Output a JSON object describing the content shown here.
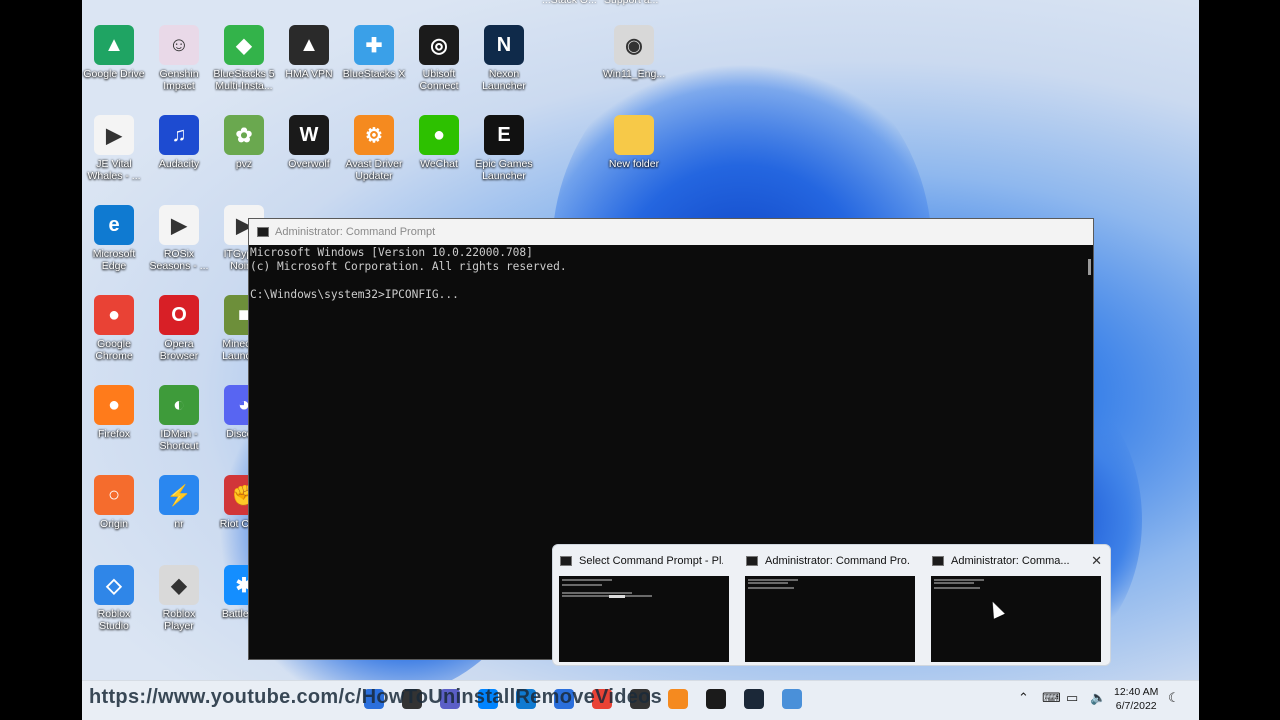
{
  "desktop_icons": [
    {
      "label": "Google Drive",
      "color": "#1fa463",
      "glyph": "▲"
    },
    {
      "label": "Genshin Impact",
      "color": "#e9d9e8",
      "glyph": "☺"
    },
    {
      "label": "BlueStacks 5 Multi-Insta...",
      "color": "#33b34a",
      "glyph": "◆"
    },
    {
      "label": "HMA VPN",
      "color": "#2a2a2a",
      "glyph": "▲"
    },
    {
      "label": "BlueStacks X",
      "color": "#3aa0e8",
      "glyph": "✚"
    },
    {
      "label": "Ubisoft Connect",
      "color": "#1b1b1b",
      "glyph": "◎"
    },
    {
      "label": "Nexon Launcher",
      "color": "#0f2a4a",
      "glyph": "N"
    },
    {
      "label": "Win11_Eng...",
      "color": "#d8d8d8",
      "glyph": "◉"
    },
    {
      "label": "JE Vital Whales - ...",
      "color": "#f4f4f4",
      "glyph": "▶"
    },
    {
      "label": "Audacity",
      "color": "#1d4bd1",
      "glyph": "♫"
    },
    {
      "label": "pvz",
      "color": "#6aa84f",
      "glyph": "✿"
    },
    {
      "label": "Overwolf",
      "color": "#1a1a1a",
      "glyph": "W"
    },
    {
      "label": "Avast Driver Updater",
      "color": "#f58a1f",
      "glyph": "⚙"
    },
    {
      "label": "WeChat",
      "color": "#2dc100",
      "glyph": "●"
    },
    {
      "label": "Epic Games Launcher",
      "color": "#111111",
      "glyph": "E"
    },
    {
      "label": "New folder",
      "color": "#f7c948",
      "glyph": ""
    },
    {
      "label": "Microsoft Edge",
      "color": "#0f7ad1",
      "glyph": "e"
    },
    {
      "label": "ROSix Seasons - ...",
      "color": "#f4f4f4",
      "glyph": "▶"
    },
    {
      "label": "ITGyph - Noir...",
      "color": "#f4f4f4",
      "glyph": "▶"
    },
    {
      "label": "Google Chrome",
      "color": "#e94235",
      "glyph": "●"
    },
    {
      "label": "Opera Browser",
      "color": "#d81f26",
      "glyph": "O"
    },
    {
      "label": "Minecraft Launcher",
      "color": "#6d8f3a",
      "glyph": "■"
    },
    {
      "label": "Firefox",
      "color": "#ff7b1b",
      "glyph": "●"
    },
    {
      "label": "IDMan - Shortcut",
      "color": "#3e9b3a",
      "glyph": "◐"
    },
    {
      "label": "Discord",
      "color": "#5865f2",
      "glyph": "◕"
    },
    {
      "label": "Origin",
      "color": "#f56c2d",
      "glyph": "○"
    },
    {
      "label": "nr",
      "color": "#2a87f0",
      "glyph": "⚡"
    },
    {
      "label": "Riot Client",
      "color": "#d13639",
      "glyph": "✊"
    },
    {
      "label": "Roblox Studio",
      "color": "#2f86e8",
      "glyph": "◇"
    },
    {
      "label": "Roblox Player",
      "color": "#d9d9d9",
      "glyph": "◆"
    },
    {
      "label": "Battle.net",
      "color": "#148eff",
      "glyph": "✱"
    }
  ],
  "top_partial_labels": [
    "...Stack O...",
    "Support a..."
  ],
  "cmd_window": {
    "title": "Administrator: Command Prompt",
    "lines": [
      "Microsoft Windows [Version 10.0.22000.708]",
      "(c) Microsoft Corporation. All rights reserved.",
      "",
      "C:\\Windows\\system32>IPCONFIG..."
    ]
  },
  "thumbnails": [
    {
      "title": "Select Command Prompt - Pl..."
    },
    {
      "title": "Administrator: Command Pro..."
    },
    {
      "title": "Administrator: Comma..."
    }
  ],
  "overlay_url": "https://www.youtube.com/c/HowToUninstallRemoveVideos",
  "clock": {
    "time": "12:40 AM",
    "date": "6/7/2022"
  },
  "taskbar_icons": [
    "start-icon",
    "search-icon",
    "teams-icon",
    "messenger-icon",
    "edge-icon",
    "store-icon",
    "chrome-icon",
    "obs-icon",
    "avast-icon",
    "terminal-icon",
    "steam-icon",
    "monitor-icon"
  ],
  "tray_icons": [
    "chevron-up-icon",
    "keyboard-icon",
    "network-icon",
    "volume-icon"
  ]
}
